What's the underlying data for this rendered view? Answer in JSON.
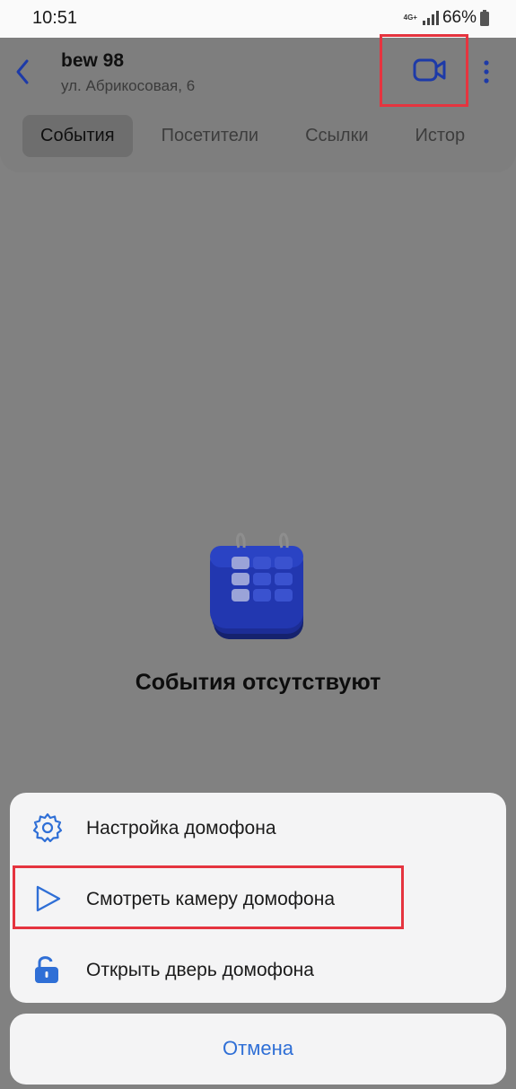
{
  "status_bar": {
    "time": "10:51",
    "network": "4G+",
    "battery": "66%"
  },
  "header": {
    "title": "bew 98",
    "subtitle": "ул. Абрикосовая, 6"
  },
  "tabs": [
    {
      "label": "События",
      "active": true
    },
    {
      "label": "Посетители",
      "active": false
    },
    {
      "label": "Ссылки",
      "active": false
    },
    {
      "label": "Истор",
      "active": false
    }
  ],
  "empty_state": {
    "text": "События отсутствуют"
  },
  "sheet": {
    "items": [
      {
        "label": "Настройка домофона",
        "icon": "gear-icon"
      },
      {
        "label": "Смотреть камеру домофона",
        "icon": "play-icon"
      },
      {
        "label": "Открыть дверь домофона",
        "icon": "unlock-icon"
      }
    ],
    "cancel_label": "Отмена"
  },
  "colors": {
    "accent": "#2f6fd6",
    "dark_accent": "#1d3aa8",
    "highlight": "#e5343f",
    "overlay": "#818181"
  }
}
